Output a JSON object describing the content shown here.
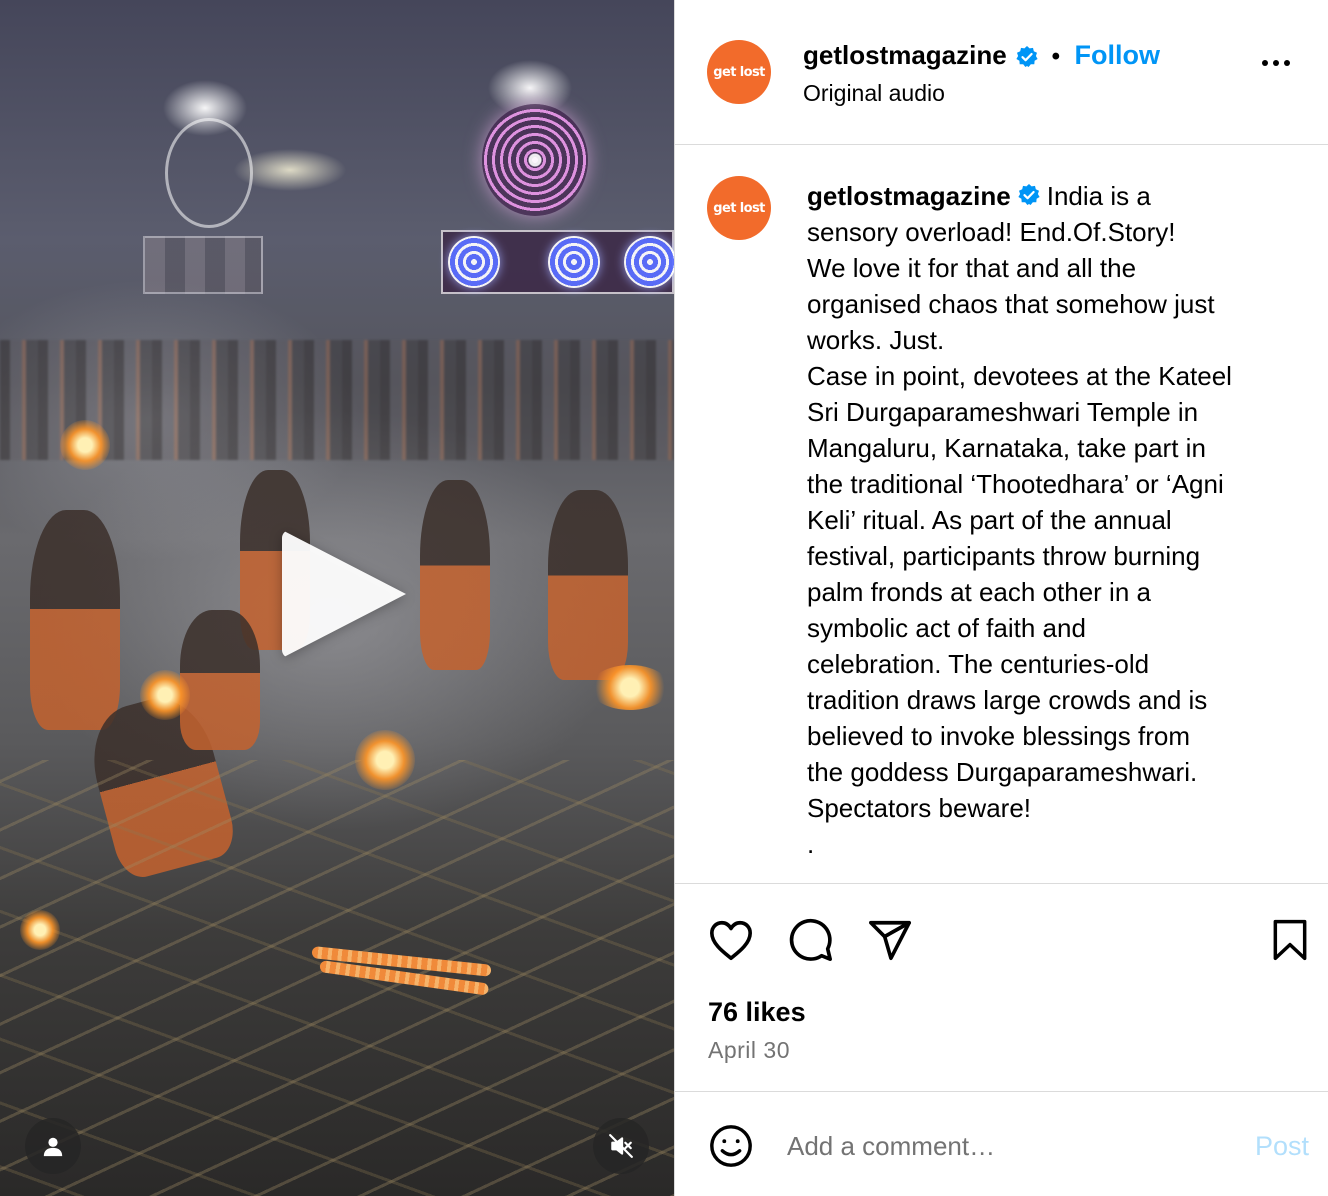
{
  "media": {
    "play_icon": "play-icon",
    "user_icon": "user-tag-icon",
    "mute_icon": "audio-muted-icon"
  },
  "header": {
    "avatar_text": "get lost",
    "username": "getlostmagazine",
    "verified_icon": "verified-badge-icon",
    "separator": "•",
    "follow_label": "Follow",
    "subtitle": "Original audio",
    "more_icon": "more-options-icon"
  },
  "caption": {
    "avatar_text": "get lost",
    "username": "getlostmagazine",
    "lines": [
      "India is a",
      "sensory overload! End.Of.Story!",
      "We love it for that and all the",
      "organised chaos that somehow just",
      "works. Just.",
      "Case in point, devotees at the Kateel",
      "Sri Durgaparameshwari Temple in",
      "Mangaluru, Karnataka, take part in",
      "the traditional ‘Thootedhara’ or ‘Agni",
      "Keli’ ritual. As part of the annual",
      "festival, participants throw burning",
      "palm fronds at each other in a",
      "symbolic act of faith and",
      "celebration. The centuries-old",
      "tradition draws large crowds and is",
      "believed to invoke blessings from",
      "the goddess Durgaparameshwari.",
      "Spectators beware!",
      "."
    ]
  },
  "actions": {
    "like_icon": "heart-icon",
    "comment_icon": "comment-icon",
    "share_icon": "share-icon",
    "save_icon": "bookmark-icon",
    "likes": "76 likes",
    "date": "April 30"
  },
  "comment": {
    "emoji_icon": "emoji-icon",
    "placeholder": "Add a comment…",
    "post_label": "Post"
  },
  "colors": {
    "accent": "#0095f6",
    "brand": "#f26b2b",
    "post_disabled": "#b2dffc",
    "muted_text": "#737373"
  }
}
